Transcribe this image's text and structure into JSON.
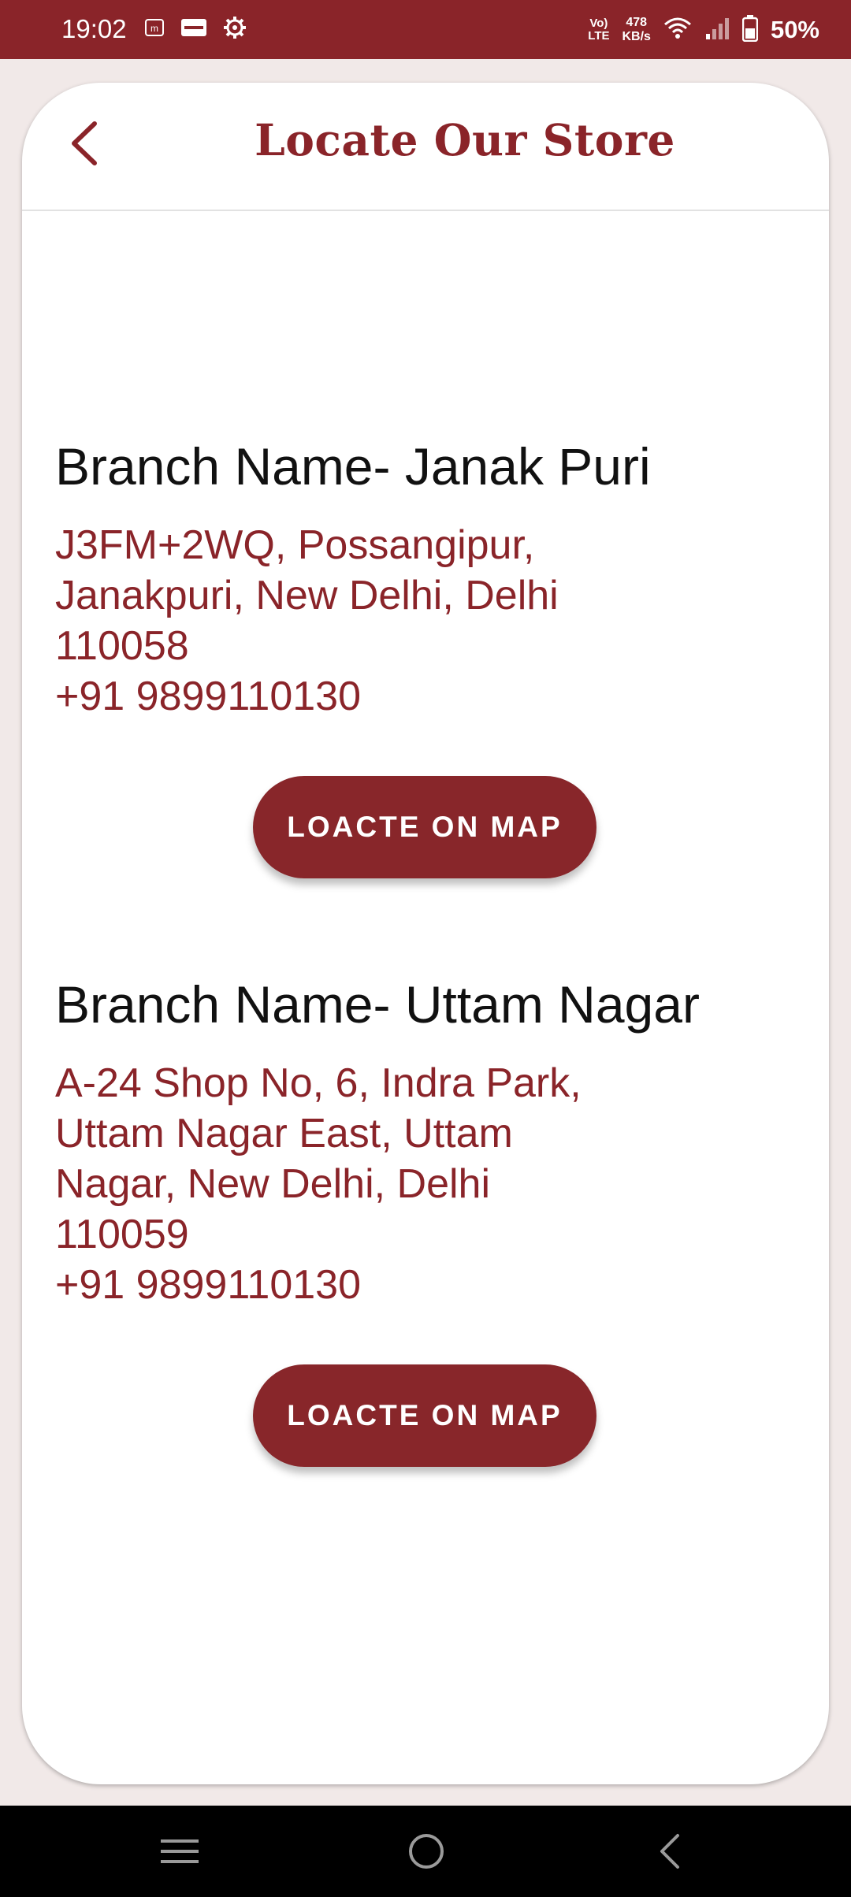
{
  "status_bar": {
    "time": "19:02",
    "network_type_top": "Vo)",
    "network_type_bottom": "LTE",
    "speed_value": "478",
    "speed_unit": "KB/s",
    "battery": "50%",
    "background_color": "#8a2429"
  },
  "header": {
    "title": "Locate Our Store",
    "back_icon": "chevron-left-icon"
  },
  "branches": [
    {
      "name": "Branch Name- Janak Puri",
      "address_lines": [
        "J3FM+2WQ, Possangipur,",
        "Janakpuri, New Delhi, Delhi",
        "110058"
      ],
      "phone": "+91 9899110130",
      "button_label": "LOACTE ON MAP"
    },
    {
      "name": "Branch Name- Uttam Nagar",
      "address_lines": [
        "A-24 Shop No, 6, Indra Park,",
        "Uttam Nagar East, Uttam",
        "Nagar, New Delhi, Delhi",
        "110059"
      ],
      "phone": "+91 9899110130",
      "button_label": "LOACTE ON MAP"
    }
  ],
  "navigation_bar": {
    "buttons": [
      "menu-icon",
      "home-icon",
      "back-icon"
    ]
  },
  "colors": {
    "accent": "#8a2429",
    "page_background": "#f1e9e8",
    "card_background": "#ffffff"
  }
}
